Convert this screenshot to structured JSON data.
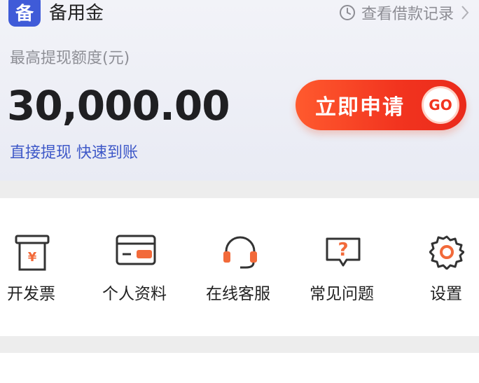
{
  "header": {
    "logo_char": "备",
    "app_name": "备用金",
    "history_link": "查看借款记录"
  },
  "limit": {
    "label": "最高提现额度(元)",
    "amount": "30,000.00",
    "promo": "直接提现 快速到账"
  },
  "apply_button": {
    "label": "立即申请",
    "badge": "GO"
  },
  "menu": {
    "items": [
      {
        "label": "开发票",
        "icon": "invoice-icon"
      },
      {
        "label": "个人资料",
        "icon": "id-card-icon"
      },
      {
        "label": "在线客服",
        "icon": "headset-icon"
      },
      {
        "label": "常见问题",
        "icon": "faq-icon"
      },
      {
        "label": "设置",
        "icon": "gear-icon"
      }
    ]
  },
  "colors": {
    "brand_blue": "#3f5bd8",
    "accent_red": "#f2341f",
    "icon_orange": "#f26a3a"
  }
}
